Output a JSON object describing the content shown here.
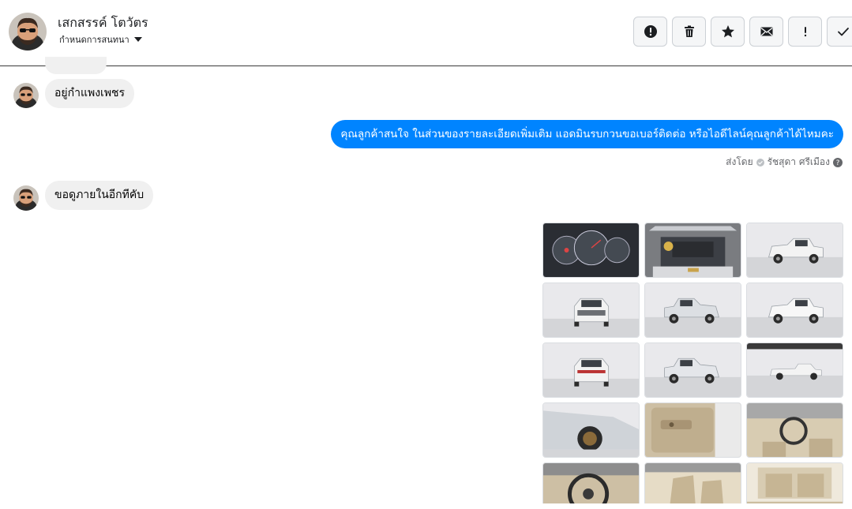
{
  "header": {
    "contact_name": "เสกสรรค์ โตวัตร",
    "conversation_settings": "กำหนดการสนทนา",
    "toolbar": [
      {
        "name": "spam-button",
        "icon": "alert-circle-icon"
      },
      {
        "name": "delete-button",
        "icon": "trash-icon"
      },
      {
        "name": "star-button",
        "icon": "star-icon"
      },
      {
        "name": "unread-button",
        "icon": "envelope-icon"
      },
      {
        "name": "follow-up-button",
        "icon": "exclamation-icon"
      },
      {
        "name": "done-button",
        "icon": "check-icon"
      }
    ]
  },
  "messages": {
    "incoming_1": "อยู่กำแพงเพชร",
    "outgoing_1": "คุณลูกค้าสนใจ ในส่วนของรายละเอียดเพิ่มเติม แอดมินรบกวนขอเบอร์ติดต่อ หรือไอดีไลน์คุณลูกค้าได้ไหมคะ",
    "sent_by_label": "ส่งโดย",
    "sent_by_name": "รัชสุดา ศรีเมือง",
    "incoming_2": "ขอดูภายในอีกทีคับ"
  },
  "photos": [
    {
      "kind": "dashboard"
    },
    {
      "kind": "engine"
    },
    {
      "kind": "truck-front-right"
    },
    {
      "kind": "truck-front"
    },
    {
      "kind": "truck-front-left"
    },
    {
      "kind": "truck-rear-right"
    },
    {
      "kind": "truck-rear"
    },
    {
      "kind": "truck-rear-left"
    },
    {
      "kind": "truck-side"
    },
    {
      "kind": "truck-wheel"
    },
    {
      "kind": "door-panel"
    },
    {
      "kind": "interior-dash"
    },
    {
      "kind": "steering-wheel"
    },
    {
      "kind": "seats"
    },
    {
      "kind": "cabin"
    }
  ],
  "colors": {
    "outgoing_bubble": "#0084ff",
    "incoming_bubble": "#f0f0f0"
  }
}
